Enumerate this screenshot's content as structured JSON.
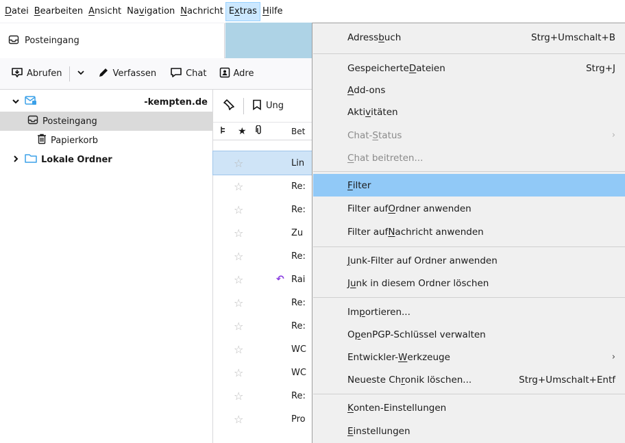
{
  "menubar": {
    "items": [
      {
        "pre": "",
        "acc": "D",
        "post": "atei"
      },
      {
        "pre": "",
        "acc": "B",
        "post": "earbeiten"
      },
      {
        "pre": "",
        "acc": "A",
        "post": "nsicht"
      },
      {
        "pre": "Na",
        "acc": "v",
        "post": "igation"
      },
      {
        "pre": "",
        "acc": "N",
        "post": "achricht"
      },
      {
        "pre": "E",
        "acc": "x",
        "post": "tras"
      },
      {
        "pre": "",
        "acc": "H",
        "post": "ilfe"
      }
    ]
  },
  "tab": {
    "label": "Posteingang"
  },
  "toolbar": {
    "get_mail": "Abrufen",
    "compose": "Verfassen",
    "chat": "Chat",
    "address_partial": "Adre"
  },
  "folders": {
    "account_label": "-kempten.de",
    "inbox": "Posteingang",
    "trash": "Papierkorb",
    "local": "Lokale Ordner"
  },
  "threads": {
    "quickfilter_unread_partial": "Ung",
    "subjects": [
      "Bet",
      "Lin",
      "Re:",
      "Re:",
      "Zu",
      "Re:",
      "Rai",
      "Re:",
      "Re:",
      "WC",
      "WC",
      "Re:",
      "Pro"
    ]
  },
  "extras_menu": {
    "addressbook": {
      "pre": "Adress",
      "acc": "b",
      "post": "uch",
      "key": "Strg+Umschalt+B"
    },
    "saved_files": {
      "pre": "Gespeicherte ",
      "acc": "D",
      "post": "ateien",
      "key": "Strg+J"
    },
    "addons": {
      "pre": "",
      "acc": "A",
      "post": "dd-ons"
    },
    "activities": {
      "pre": "Akti",
      "acc": "v",
      "post": "itäten"
    },
    "chat_status": {
      "pre": "Chat-",
      "acc": "S",
      "post": "tatus"
    },
    "join_chat": {
      "pre": "",
      "acc": "C",
      "post": "hat beitreten..."
    },
    "filter": {
      "pre": "",
      "acc": "F",
      "post": "ilter"
    },
    "filter_folder": {
      "pre": "Filter auf ",
      "acc": "O",
      "post": "rdner anwenden"
    },
    "filter_message": {
      "pre": "Filter auf ",
      "acc": "N",
      "post": "achricht anwenden"
    },
    "junk_folder": {
      "pre": "",
      "acc": "J",
      "post": "unk-Filter auf Ordner anwenden"
    },
    "junk_delete": {
      "pre": "J",
      "acc": "u",
      "post": "nk in diesem Ordner löschen"
    },
    "import": {
      "pre": "Im",
      "acc": "p",
      "post": "ortieren..."
    },
    "openpgp": {
      "pre": "O",
      "acc": "p",
      "post": "enPGP-Schlüssel verwalten"
    },
    "devtools": {
      "pre": "Entwickler-",
      "acc": "W",
      "post": "erkzeuge"
    },
    "clear_history": {
      "pre": "Neueste Ch",
      "acc": "r",
      "post": "onik löschen...",
      "key": "Strg+Umschalt+Entf"
    },
    "account_settings": {
      "pre": "",
      "acc": "K",
      "post": "onten-Einstellungen"
    },
    "settings": {
      "pre": "",
      "acc": "E",
      "post": "instellungen"
    }
  },
  "colors": {
    "menu_highlight": "#91c9f7",
    "selection": "#cfe4f7",
    "folder_icon": "#3aa0e8",
    "reply_icon": "#8a3ee0"
  }
}
